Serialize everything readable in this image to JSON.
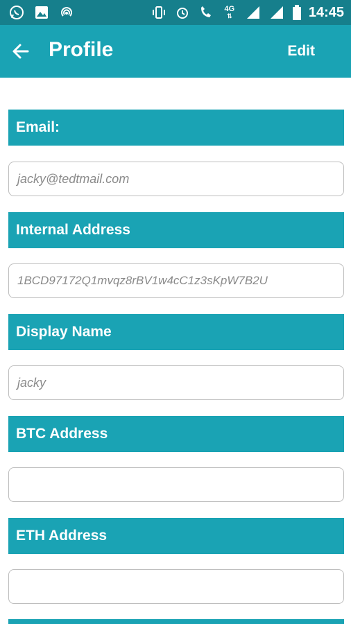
{
  "status_bar": {
    "time": "14:45",
    "network": "4G",
    "left_icons": [
      "whatsapp-icon",
      "gallery-icon",
      "hotspot-icon"
    ],
    "right_icons": [
      "vibrate-icon",
      "alarm-icon",
      "wifi-call-icon",
      "4g-icon",
      "signal-icon",
      "signal-icon",
      "battery-icon"
    ]
  },
  "app_bar": {
    "title": "Profile",
    "edit_label": "Edit"
  },
  "sections": [
    {
      "label": "Email:",
      "value": "jacky@tedtmail.com"
    },
    {
      "label": "Internal Address",
      "value": "1BCD97172Q1mvqz8rBV1w4cC1z3sKpW7B2U"
    },
    {
      "label": "Display Name",
      "value": "jacky"
    },
    {
      "label": "BTC Address",
      "value": ""
    },
    {
      "label": "ETH Address",
      "value": ""
    }
  ],
  "colors": {
    "status_bar": "#167f8c",
    "primary": "#1aa3b4",
    "text_on_primary": "#ffffff",
    "field_text": "#8a8a8a",
    "field_border": "#bdbdbd"
  }
}
